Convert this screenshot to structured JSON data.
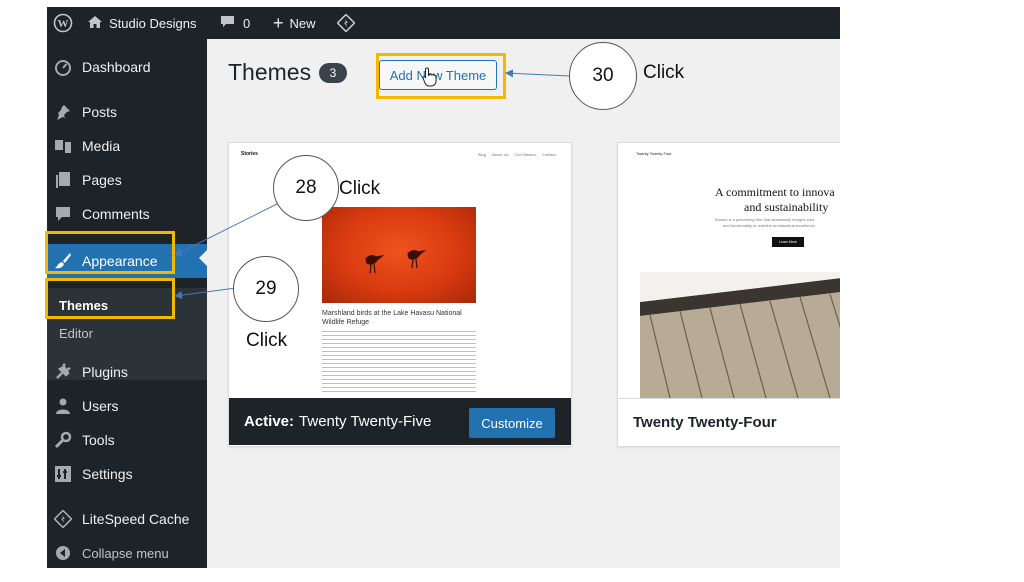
{
  "admin_bar": {
    "site_name": "Studio Designs",
    "comments_count": "0",
    "new_label": "New"
  },
  "sidebar": {
    "items": [
      {
        "label": "Dashboard",
        "icon": "dashboard-icon"
      },
      {
        "label": "Posts",
        "icon": "pin-icon"
      },
      {
        "label": "Media",
        "icon": "media-icon"
      },
      {
        "label": "Pages",
        "icon": "pages-icon"
      },
      {
        "label": "Comments",
        "icon": "comments-icon"
      },
      {
        "label": "Appearance",
        "icon": "paintbrush-icon"
      },
      {
        "label": "Plugins",
        "icon": "plugins-icon"
      },
      {
        "label": "Users",
        "icon": "users-icon"
      },
      {
        "label": "Tools",
        "icon": "wrench-icon"
      },
      {
        "label": "Settings",
        "icon": "settings-icon"
      },
      {
        "label": "LiteSpeed Cache",
        "icon": "litespeed-icon"
      },
      {
        "label": "Collapse menu",
        "icon": "collapse-icon"
      }
    ],
    "submenu": [
      "Themes",
      "Editor"
    ]
  },
  "page": {
    "title": "Themes",
    "count": "3",
    "add_new_label": "Add New Theme"
  },
  "themes": {
    "active": {
      "prefix": "Active:",
      "name": "Twenty Twenty-Five",
      "customize_label": "Customize",
      "preview": {
        "site": "Stories",
        "nav": [
          "Blog",
          "About Us",
          "Our Mission",
          "Contact"
        ],
        "headline": "Marshland birds at the Lake Havasu National Wildlife Refuge"
      }
    },
    "second": {
      "name": "Twenty Twenty-Four",
      "preview": {
        "site": "Twenty Twenty Four",
        "headline_line1": "A commitment to innova",
        "headline_line2": "and sustainability",
        "body_line1": "Études is a pioneering firm that seamlessly merges crea",
        "body_line2": "and functionality to redefine architectural excellence.",
        "button": "Learn More"
      }
    }
  },
  "annotations": [
    {
      "number": "28",
      "label": "Click"
    },
    {
      "number": "29",
      "label": "Click"
    },
    {
      "number": "30",
      "label": "Click"
    }
  ],
  "colors": {
    "admin_dark": "#1d2327",
    "wp_blue": "#2271b1",
    "highlight": "#f5b800"
  }
}
